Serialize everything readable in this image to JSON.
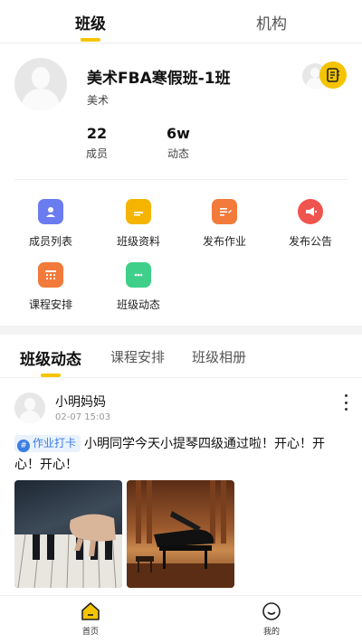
{
  "top_tabs": [
    {
      "label": "班级",
      "active": true
    },
    {
      "label": "机构",
      "active": false
    }
  ],
  "class_info": {
    "name": "美术FBA寒假班-1班",
    "subject": "美术",
    "stats": [
      {
        "value": "22",
        "label": "成员"
      },
      {
        "value": "6w",
        "label": "动态"
      }
    ]
  },
  "features": [
    {
      "label": "成员列表",
      "icon": "member-list-icon",
      "color": "#6b7cf0"
    },
    {
      "label": "班级资料",
      "icon": "class-files-icon",
      "color": "#f5b400"
    },
    {
      "label": "发布作业",
      "icon": "publish-homework-icon",
      "color": "#f27a3a"
    },
    {
      "label": "发布公告",
      "icon": "megaphone-icon",
      "color": "#f0544f"
    },
    {
      "label": "课程安排",
      "icon": "schedule-icon",
      "color": "#f27a3a"
    },
    {
      "label": "班级动态",
      "icon": "chat-icon",
      "color": "#3fcf8a"
    }
  ],
  "content_tabs": [
    {
      "label": "班级动态",
      "active": true
    },
    {
      "label": "课程安排",
      "active": false
    },
    {
      "label": "班级相册",
      "active": false
    }
  ],
  "post": {
    "author": "小明妈妈",
    "time": "02-07 15:03",
    "tag": "作业打卡",
    "text": "小明同学今天小提琴四级通过啦！开心！开心！开心！",
    "photos": [
      "piano-keys-photo",
      "grand-piano-photo"
    ]
  },
  "bottom_nav": [
    {
      "label": "首页",
      "icon": "home-icon",
      "active": true
    },
    {
      "label": "我的",
      "icon": "profile-icon",
      "active": false
    }
  ],
  "colors": {
    "accent": "#f5c400",
    "tag_bg": "#e9f2fd",
    "tag_text": "#3b7ee2"
  }
}
